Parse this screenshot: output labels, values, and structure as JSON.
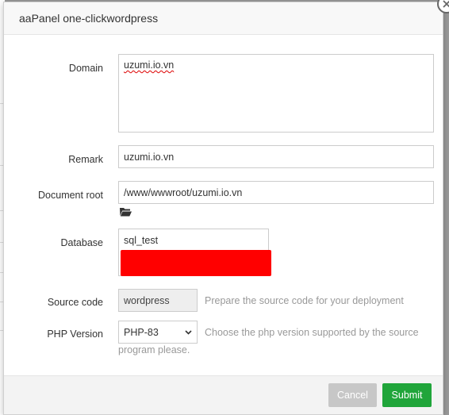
{
  "dialog": {
    "title": "aaPanel one-clickwordpress"
  },
  "form": {
    "domain": {
      "label": "Domain",
      "value": "uzumi.io.vn"
    },
    "remark": {
      "label": "Remark",
      "value": "uzumi.io.vn"
    },
    "document_root": {
      "label": "Document root",
      "value": "/www/wwwroot/uzumi.io.vn",
      "icon": "folder-open-icon"
    },
    "database": {
      "label": "Database",
      "value": "sql_test",
      "redacted_color": "#ff0000"
    },
    "source_code": {
      "label": "Source code",
      "value": "wordpress",
      "hint": "Prepare the source code for your deployment"
    },
    "php_version": {
      "label": "PHP Version",
      "value": "PHP-83",
      "hint_line1": "Choose the php version supported by the source",
      "hint_line2": "program please."
    }
  },
  "footer": {
    "cancel_label": "Cancel",
    "submit_label": "Submit"
  },
  "colors": {
    "accent": "#20a53a",
    "cancel": "#c7c7c7"
  }
}
